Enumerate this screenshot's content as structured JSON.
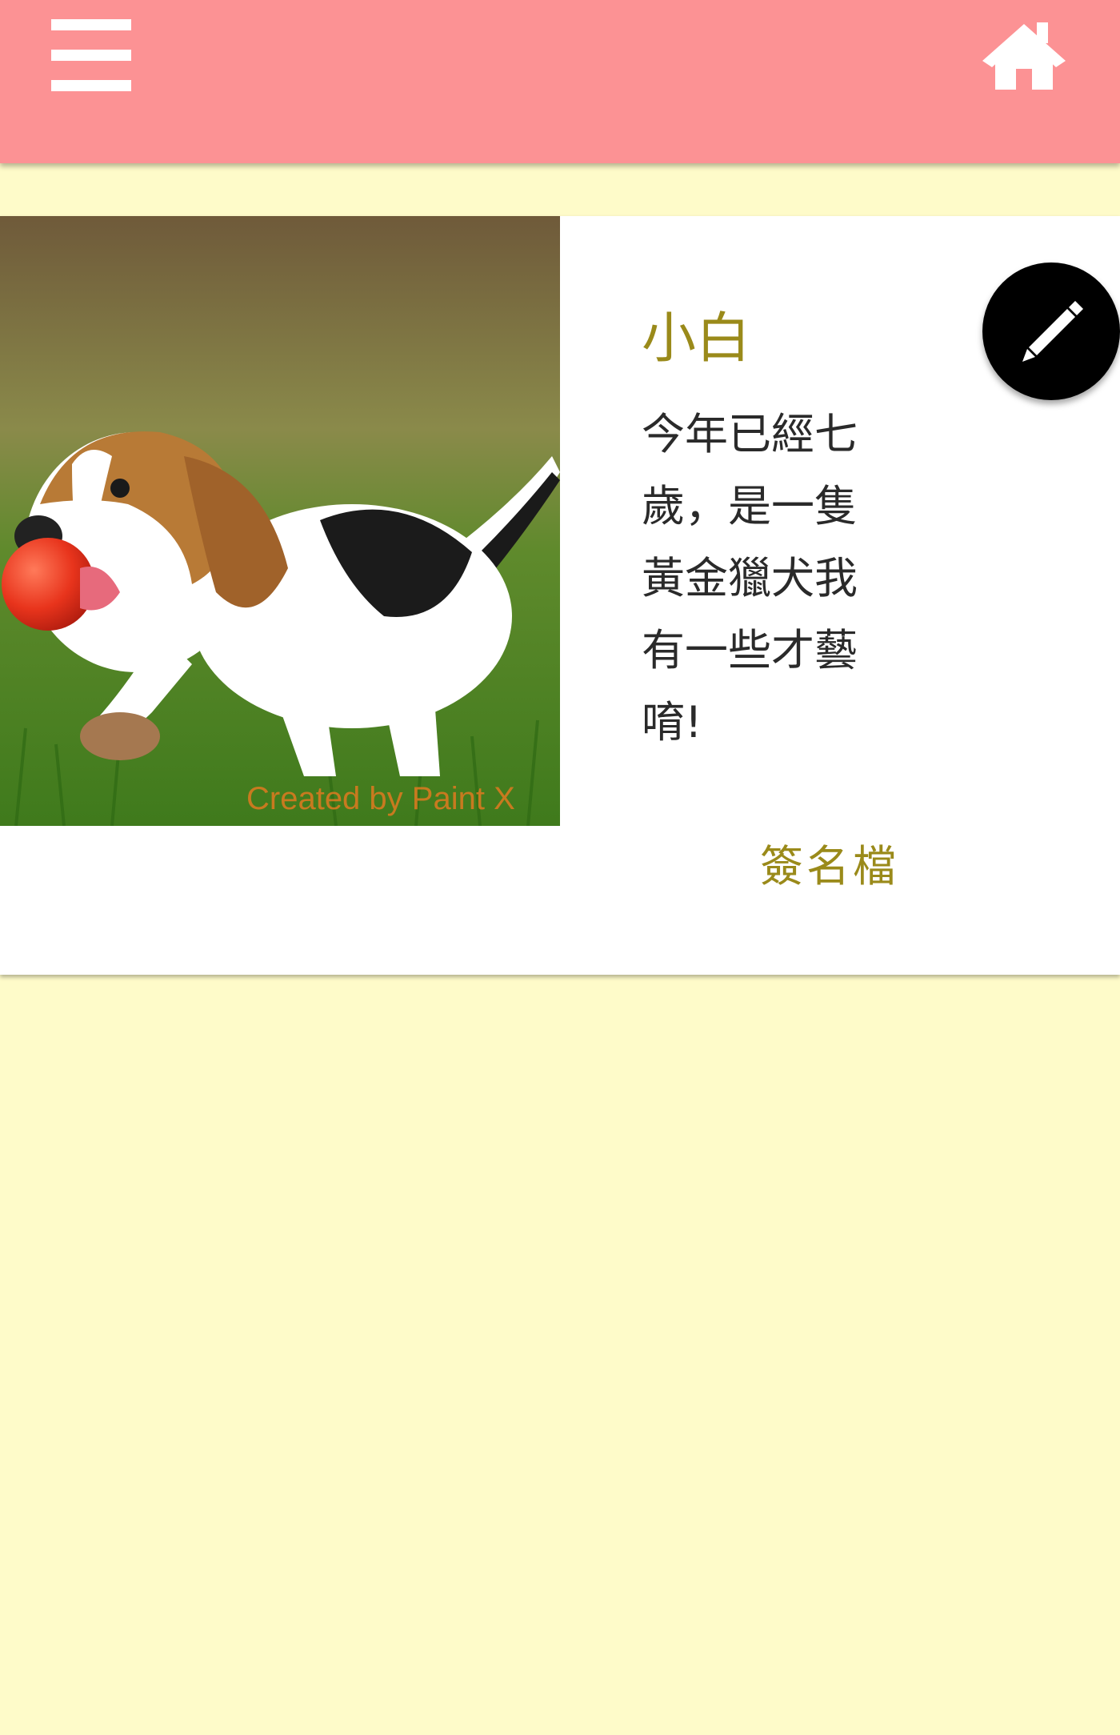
{
  "header": {
    "background_color": "#fc9294",
    "menu_icon": "hamburger-menu-icon",
    "home_icon": "home-icon"
  },
  "pet_card": {
    "name": "小白",
    "description": "今年已經七歲，是一隻黃金獵犬我有一些才藝唷!",
    "photo_watermark": "Created by Paint X",
    "guestbook_label": "簽名檔",
    "edit_icon": "pencil-icon",
    "name_color": "#9a8a1a"
  },
  "page": {
    "background_color": "#fefbc9"
  }
}
